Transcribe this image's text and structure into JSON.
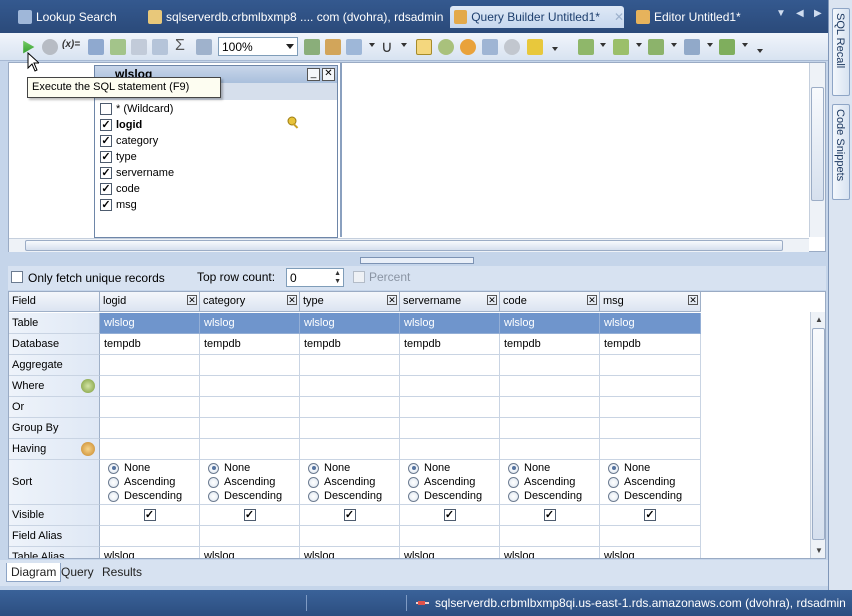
{
  "tabs": [
    {
      "label": "Lookup Search",
      "active": false
    },
    {
      "label": "sqlserverdb.crbmlbxmp8 .... com (dvohra), rdsadmin",
      "active": false
    },
    {
      "label": "Query Builder Untitled1*",
      "active": true
    },
    {
      "label": "Editor Untitled1*",
      "active": false
    }
  ],
  "side_panels": [
    "SQL Recall",
    "Code Snippets"
  ],
  "toolbar": {
    "zoom_value": "100%",
    "tooltip": "Execute the SQL statement (F9)",
    "function_label": "(x)="
  },
  "diagram": {
    "table_name": "wlslog",
    "columns": [
      {
        "label": "* (Wildcard)",
        "checked": false
      },
      {
        "label": "logid",
        "checked": true,
        "bold": true
      },
      {
        "label": "category",
        "checked": true
      },
      {
        "label": "type",
        "checked": true
      },
      {
        "label": "servername",
        "checked": true
      },
      {
        "label": "code",
        "checked": true
      },
      {
        "label": "msg",
        "checked": true
      }
    ]
  },
  "options": {
    "unique_label": "Only fetch unique records",
    "top_row_label": "Top row count:",
    "top_row_value": "0",
    "percent_label": "Percent"
  },
  "grid": {
    "field_header": "Field",
    "row_labels": [
      "Table",
      "Database",
      "Aggregate",
      "Where",
      "Or",
      "Group By",
      "Having",
      "Sort",
      "Visible",
      "Field Alias",
      "Table Alias"
    ],
    "columns": [
      {
        "name": "logid",
        "table": "wlslog",
        "database": "tempdb",
        "alias": "wlslog"
      },
      {
        "name": "category",
        "table": "wlslog",
        "database": "tempdb",
        "alias": "wlslog"
      },
      {
        "name": "type",
        "table": "wlslog",
        "database": "tempdb",
        "alias": "wlslog"
      },
      {
        "name": "servername",
        "table": "wlslog",
        "database": "tempdb",
        "alias": "wlslog"
      },
      {
        "name": "code",
        "table": "wlslog",
        "database": "tempdb",
        "alias": "wlslog"
      },
      {
        "name": "msg",
        "table": "wlslog",
        "database": "tempdb",
        "alias": "wlslog"
      }
    ],
    "sort_options": [
      "None",
      "Ascending",
      "Descending"
    ],
    "sort_selected": "None"
  },
  "bottom_tabs": [
    {
      "label": "Diagram",
      "active": true
    },
    {
      "label": "Query",
      "active": false
    },
    {
      "label": "Results",
      "active": false
    }
  ],
  "status": {
    "connection": "sqlserverdb.crbmlbxmp8qi.us-east-1.rds.amazonaws.com (dvohra), rdsadmin"
  },
  "colors": {
    "selected_row": "#6f95cc",
    "tab_bar": "#34598f",
    "status_bar": "#2c4e80"
  }
}
